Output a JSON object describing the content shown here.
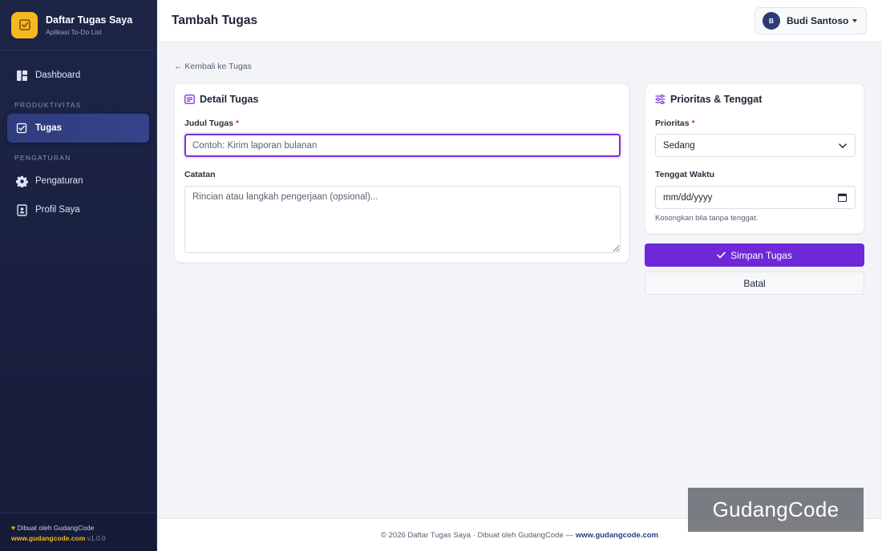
{
  "brand": {
    "title": "Daftar Tugas Saya",
    "subtitle": "Aplikasi To-Do List",
    "logo_icon": "check-square-icon",
    "accent": "#f5b920"
  },
  "sidebar": {
    "items": [
      {
        "label": "Dashboard",
        "icon": "dashboard-icon"
      }
    ],
    "section_productivity": "PRODUKTIVITAS",
    "productivity_items": [
      {
        "label": "Tugas",
        "icon": "check-square-icon",
        "active": true
      }
    ],
    "section_settings": "PENGATURAN",
    "settings_items": [
      {
        "label": "Pengaturan",
        "icon": "gear-icon"
      },
      {
        "label": "Profil Saya",
        "icon": "id-badge-icon"
      }
    ],
    "footer": {
      "made_by": "Dibuat oleh GudangCode",
      "site": "www.gudangcode.com",
      "version": "v1.0.0"
    }
  },
  "header": {
    "title": "Tambah Tugas",
    "user": {
      "initial": "B",
      "name": "Budi Santoso"
    }
  },
  "main": {
    "back_link": "← Kembali ke Tugas",
    "detail_card": {
      "title": "Detail Tugas",
      "title_label": "Judul Tugas",
      "required_mark": "*",
      "title_placeholder": "Contoh: Kirim laporan bulanan",
      "notes_label": "Catatan",
      "notes_placeholder": "Rincian atau langkah pengerjaan (opsional)..."
    },
    "priority_card": {
      "title": "Prioritas & Tenggat",
      "priority_label": "Prioritas",
      "required_mark": "*",
      "priority_value": "Sedang",
      "deadline_label": "Tenggat Waktu",
      "deadline_placeholder": "mm/dd/yyyy",
      "deadline_help": "Kosongkan bila tanpa tenggat."
    },
    "save_label": "Simpan Tugas",
    "cancel_label": "Batal",
    "primary_color": "#6e28d9"
  },
  "footer": {
    "text": "© 2026 Daftar Tugas Saya · Dibuat oleh GudangCode —",
    "site": "www.gudangcode.com"
  },
  "watermark": "GudangCode"
}
